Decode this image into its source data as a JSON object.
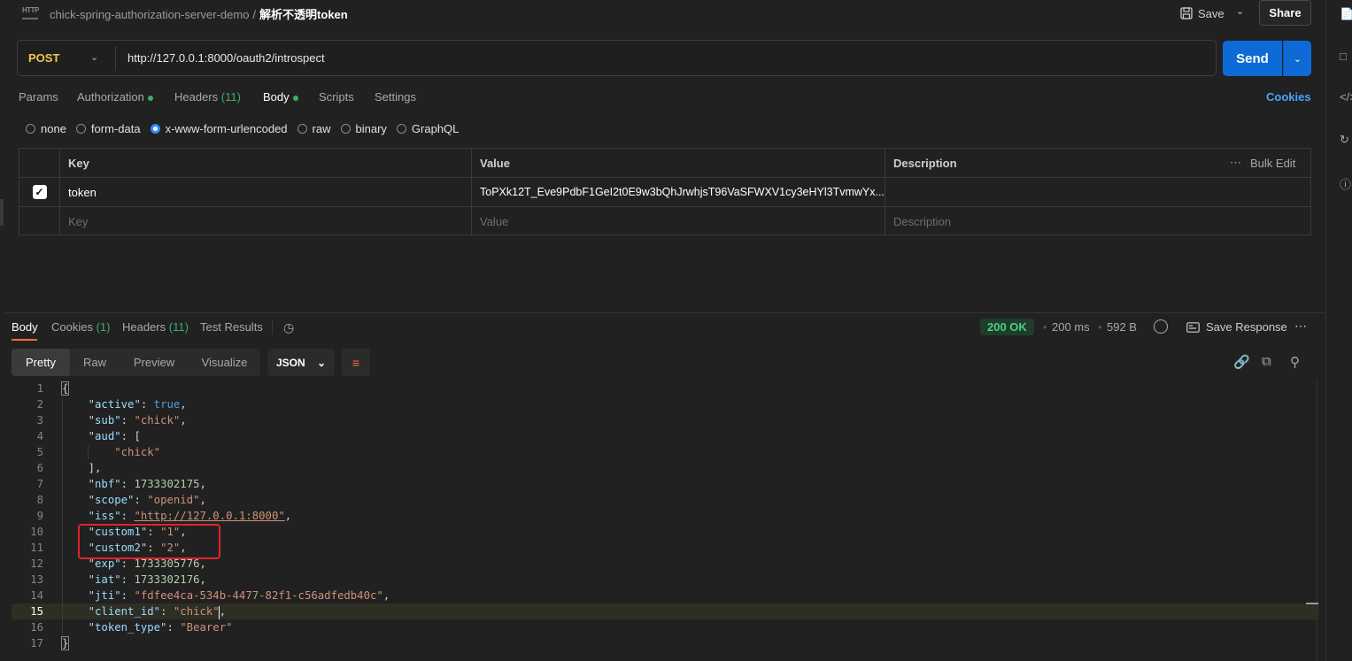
{
  "header": {
    "breadcrumb_parent": "chick-spring-authorization-server-demo",
    "breadcrumb_sep": "/",
    "breadcrumb_current": "解析不透明token",
    "save_label": "Save",
    "share_label": "Share"
  },
  "request": {
    "method": "POST",
    "url": "http://127.0.0.1:8000/oauth2/introspect",
    "send_label": "Send"
  },
  "request_tabs": [
    {
      "label": "Params"
    },
    {
      "label": "Authorization",
      "dot": true
    },
    {
      "label": "Headers",
      "count": "(11)"
    },
    {
      "label": "Body",
      "dot": true,
      "active": true
    },
    {
      "label": "Scripts"
    },
    {
      "label": "Settings"
    }
  ],
  "cookies_label": "Cookies",
  "body_types": [
    {
      "label": "none"
    },
    {
      "label": "form-data"
    },
    {
      "label": "x-www-form-urlencoded",
      "selected": true
    },
    {
      "label": "raw"
    },
    {
      "label": "binary"
    },
    {
      "label": "GraphQL"
    }
  ],
  "params_table": {
    "headers": {
      "key": "Key",
      "value": "Value",
      "description": "Description",
      "bulk_edit": "Bulk Edit"
    },
    "rows": [
      {
        "checked": true,
        "key": "token",
        "value": "ToPXk12T_Eve9PdbF1GeI2t0E9w3bQhJrwhjsT96VaSFWXV1cy3eHYl3TvmwYx...",
        "description": ""
      }
    ],
    "placeholders": {
      "key": "Key",
      "value": "Value",
      "description": "Description"
    }
  },
  "response_tabs": [
    {
      "label": "Body",
      "active": true
    },
    {
      "label": "Cookies",
      "count": "(1)"
    },
    {
      "label": "Headers",
      "count": "(11)"
    },
    {
      "label": "Test Results"
    }
  ],
  "response_meta": {
    "status": "200 OK",
    "time": "200 ms",
    "size": "592 B",
    "save_response_label": "Save Response"
  },
  "view_modes": [
    "Pretty",
    "Raw",
    "Preview",
    "Visualize"
  ],
  "active_view": "Pretty",
  "format": "JSON",
  "current_line": 15,
  "code_lines": [
    [
      {
        "t": "{",
        "c": "brace"
      }
    ],
    [
      {
        "t": "    "
      },
      {
        "t": "\"active\"",
        "c": "k"
      },
      {
        "t": ": ",
        "c": "p"
      },
      {
        "t": "true",
        "c": "b"
      },
      {
        "t": ",",
        "c": "p"
      }
    ],
    [
      {
        "t": "    "
      },
      {
        "t": "\"sub\"",
        "c": "k"
      },
      {
        "t": ": ",
        "c": "p"
      },
      {
        "t": "\"chick\"",
        "c": "s"
      },
      {
        "t": ",",
        "c": "p"
      }
    ],
    [
      {
        "t": "    "
      },
      {
        "t": "\"aud\"",
        "c": "k"
      },
      {
        "t": ": [",
        "c": "p"
      }
    ],
    [
      {
        "t": "        "
      },
      {
        "t": "\"chick\"",
        "c": "s"
      }
    ],
    [
      {
        "t": "    "
      },
      {
        "t": "],",
        "c": "p"
      }
    ],
    [
      {
        "t": "    "
      },
      {
        "t": "\"nbf\"",
        "c": "k"
      },
      {
        "t": ": ",
        "c": "p"
      },
      {
        "t": "1733302175",
        "c": "n"
      },
      {
        "t": ",",
        "c": "p"
      }
    ],
    [
      {
        "t": "    "
      },
      {
        "t": "\"scope\"",
        "c": "k"
      },
      {
        "t": ": ",
        "c": "p"
      },
      {
        "t": "\"openid\"",
        "c": "s"
      },
      {
        "t": ",",
        "c": "p"
      }
    ],
    [
      {
        "t": "    "
      },
      {
        "t": "\"iss\"",
        "c": "k"
      },
      {
        "t": ": ",
        "c": "p"
      },
      {
        "t": "\"http://127.0.0.1:8000\"",
        "c": "s u"
      },
      {
        "t": ",",
        "c": "p"
      }
    ],
    [
      {
        "t": "    "
      },
      {
        "t": "\"custom1\"",
        "c": "k"
      },
      {
        "t": ": ",
        "c": "p"
      },
      {
        "t": "\"1\"",
        "c": "s"
      },
      {
        "t": ",",
        "c": "p"
      }
    ],
    [
      {
        "t": "    "
      },
      {
        "t": "\"custom2\"",
        "c": "k"
      },
      {
        "t": ": ",
        "c": "p"
      },
      {
        "t": "\"2\"",
        "c": "s"
      },
      {
        "t": ",",
        "c": "p"
      }
    ],
    [
      {
        "t": "    "
      },
      {
        "t": "\"exp\"",
        "c": "k"
      },
      {
        "t": ": ",
        "c": "p"
      },
      {
        "t": "1733305776",
        "c": "n"
      },
      {
        "t": ",",
        "c": "p"
      }
    ],
    [
      {
        "t": "    "
      },
      {
        "t": "\"iat\"",
        "c": "k"
      },
      {
        "t": ": ",
        "c": "p"
      },
      {
        "t": "1733302176",
        "c": "n"
      },
      {
        "t": ",",
        "c": "p"
      }
    ],
    [
      {
        "t": "    "
      },
      {
        "t": "\"jti\"",
        "c": "k"
      },
      {
        "t": ": ",
        "c": "p"
      },
      {
        "t": "\"fdfee4ca-534b-4477-82f1-c56adfedb40c\"",
        "c": "s"
      },
      {
        "t": ",",
        "c": "p"
      }
    ],
    [
      {
        "t": "    "
      },
      {
        "t": "\"client_id\"",
        "c": "k"
      },
      {
        "t": ": ",
        "c": "p"
      },
      {
        "t": "\"chick\"",
        "c": "s"
      },
      {
        "t": ",",
        "c": "p"
      }
    ],
    [
      {
        "t": "    "
      },
      {
        "t": "\"token_type\"",
        "c": "k"
      },
      {
        "t": ": ",
        "c": "p"
      },
      {
        "t": "\"Bearer\"",
        "c": "s"
      }
    ],
    [
      {
        "t": "}",
        "c": "brace"
      }
    ]
  ],
  "colors": {
    "accent": "#ff6c37",
    "send": "#0e6bd6",
    "method": "#f5c451",
    "status_ok": "#4cd07d",
    "annotation_box": "#e0232b"
  }
}
